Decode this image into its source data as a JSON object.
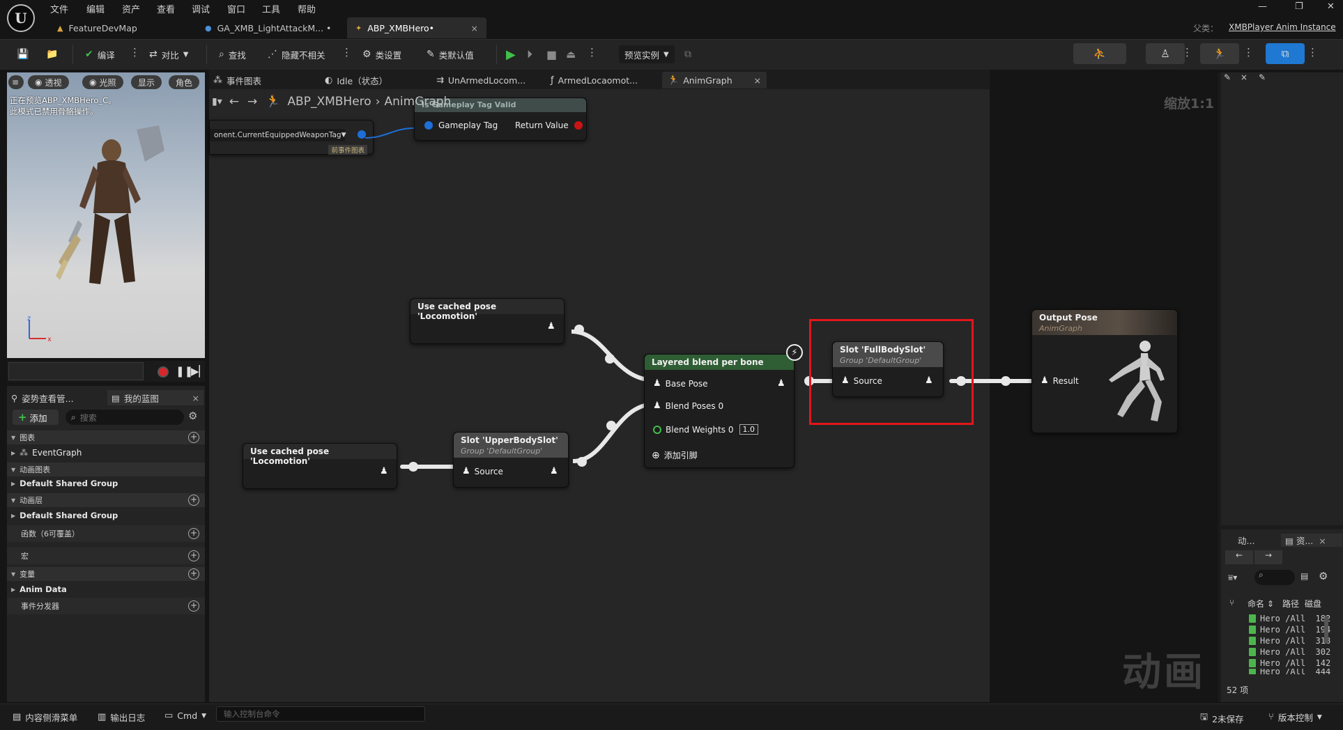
{
  "menu": [
    "文件",
    "编辑",
    "资产",
    "查看",
    "调试",
    "窗口",
    "工具",
    "帮助"
  ],
  "doc_tabs": [
    {
      "label": "FeatureDevMap"
    },
    {
      "label": "GA_XMB_LightAttackM... •"
    },
    {
      "label": "ABP_XMBHero•",
      "close": "×"
    }
  ],
  "parent": {
    "label": "父类：",
    "value": "XMBPlayer Anim Instance"
  },
  "toolbar": {
    "compile": "编译",
    "diff": "对比",
    "find": "查找",
    "hide_unrelated": "隐藏不相关",
    "class_settings": "类设置",
    "class_defaults": "类默认值",
    "preview_instance": "预览实例"
  },
  "viewport": {
    "pills": [
      "透视",
      "光照",
      "显示",
      "角色"
    ],
    "message_line1": "正在预览ABP_XMBHero_C。",
    "message_line2": "此模式已禁用骨骼操作。",
    "axis_x": "x",
    "axis_z": "z"
  },
  "left_panel": {
    "tab_pose": "姿势查看管...",
    "tab_blueprint": "我的蓝图",
    "add": "添加",
    "search_placeholder": "搜索",
    "sections": {
      "graphs": "图表",
      "event_graph": "EventGraph",
      "anim_graphs": "动画图表",
      "default_shared_group_1": "Default Shared Group",
      "anim_layers": "动画层",
      "default_shared_group_2": "Default Shared Group",
      "functions": "函数（6可覆盖）",
      "macros": "宏",
      "variables": "变量",
      "anim_data": "Anim Data",
      "event_dispatchers": "事件分发器"
    }
  },
  "graph_tabs": [
    {
      "label": "事件图表"
    },
    {
      "label": "Idle（状态）"
    },
    {
      "label": "UnArmedLocom..."
    },
    {
      "label": "ArmedLocaomot..."
    },
    {
      "label": "AnimGraph",
      "close": "×"
    }
  ],
  "breadcrumb": {
    "root": "ABP_XMBHero",
    "child": "AnimGraph"
  },
  "zoom": "缩放1:1",
  "watermark": "动画",
  "nodes": {
    "weapon_tag": {
      "label": "onent.CurrentEquippedWeaponTag",
      "note": "前事件图表"
    },
    "tag_valid": {
      "title": "Is Gameplay Tag Valid",
      "in": "Gameplay Tag",
      "out": "Return Value"
    },
    "cached_pose_1": {
      "title": "Use cached pose 'Locomotion'"
    },
    "cached_pose_2": {
      "title": "Use cached pose 'Locomotion'"
    },
    "upper_slot": {
      "title": "Slot 'UpperBodySlot'",
      "group": "Group 'DefaultGroup'",
      "pin": "Source"
    },
    "layered_blend": {
      "title": "Layered blend per bone",
      "base_pose": "Base Pose",
      "blend_poses": "Blend Poses 0",
      "blend_weights": "Blend Weights 0",
      "weight_value": "1.0",
      "add_pin": "添加引脚"
    },
    "full_slot": {
      "title": "Slot 'FullBodySlot'",
      "group": "Group 'DefaultGroup'",
      "pin": "Source"
    },
    "output_pose": {
      "title": "Output Pose",
      "sub": "AnimGraph",
      "pin": "Result"
    }
  },
  "right_panel": {
    "tab_anim": "动...",
    "tab_assets": "资...",
    "col_name": "命名",
    "col_path": "路径",
    "col_disk": "磁盘",
    "assets": [
      {
        "name": "Hero",
        "path": "/All",
        "disk": "182"
      },
      {
        "name": "Hero",
        "path": "/All",
        "disk": "194"
      },
      {
        "name": "Hero",
        "path": "/All",
        "disk": "318"
      },
      {
        "name": "Hero",
        "path": "/All",
        "disk": "302"
      },
      {
        "name": "Hero",
        "path": "/All",
        "disk": "142"
      },
      {
        "name": "Hero",
        "path": "/All",
        "disk": "444"
      }
    ],
    "count": "52 项"
  },
  "statusbar": {
    "content_drawer": "内容侧滑菜单",
    "output_log": "输出日志",
    "cmd": "Cmd",
    "cmd_placeholder": "输入控制台命令",
    "unsaved": "2未保存",
    "source_control": "版本控制"
  },
  "colors": {
    "highlight": "#e4151b",
    "play": "#3fbf4a",
    "node_green": "#2f5d34",
    "pin_blue": "#1e6fd8",
    "pin_red": "#c81414"
  }
}
